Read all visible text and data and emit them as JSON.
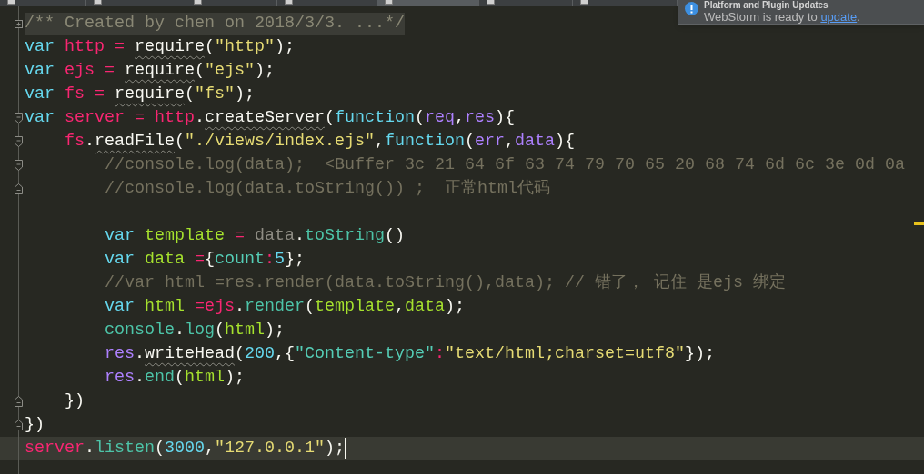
{
  "tabs": [
    {
      "selected": false
    },
    {
      "selected": false
    },
    {
      "selected": false
    },
    {
      "selected": false
    },
    {
      "selected": true
    },
    {
      "selected": false
    },
    {
      "selected": false
    }
  ],
  "notification": {
    "title": "Platform and Plugin Updates",
    "message": "WebStorm is ready to",
    "link": "update",
    "after_link": "."
  },
  "editor": {
    "lines": [
      {
        "kind": "folded",
        "current": false,
        "tokens": [
          {
            "text": "/** Created by chen on 2018/3/3. ...*/",
            "kind": "folded"
          }
        ]
      },
      {
        "kind": "plain",
        "current": false,
        "tokens": [
          {
            "text": "var ",
            "kind": "keyword"
          },
          {
            "text": "http ",
            "kind": "variable"
          },
          {
            "text": "= ",
            "kind": "operator"
          },
          {
            "text": "require",
            "kind": "unresolved"
          },
          {
            "text": "(",
            "kind": "plain"
          },
          {
            "text": "\"http\"",
            "kind": "string"
          },
          {
            "text": ");",
            "kind": "plain"
          }
        ]
      },
      {
        "kind": "plain",
        "current": false,
        "tokens": [
          {
            "text": "var ",
            "kind": "keyword"
          },
          {
            "text": "ejs ",
            "kind": "variable"
          },
          {
            "text": "= ",
            "kind": "operator"
          },
          {
            "text": "require",
            "kind": "unresolved"
          },
          {
            "text": "(",
            "kind": "plain"
          },
          {
            "text": "\"ejs\"",
            "kind": "string"
          },
          {
            "text": ");",
            "kind": "plain"
          }
        ]
      },
      {
        "kind": "plain",
        "current": false,
        "tokens": [
          {
            "text": "var ",
            "kind": "keyword"
          },
          {
            "text": "fs ",
            "kind": "variable"
          },
          {
            "text": "= ",
            "kind": "operator"
          },
          {
            "text": "require",
            "kind": "unresolved"
          },
          {
            "text": "(",
            "kind": "plain"
          },
          {
            "text": "\"fs\"",
            "kind": "string"
          },
          {
            "text": ");",
            "kind": "plain"
          }
        ]
      },
      {
        "kind": "fold_start",
        "current": false,
        "tokens": [
          {
            "text": "var ",
            "kind": "keyword"
          },
          {
            "text": "server ",
            "kind": "variable"
          },
          {
            "text": "= ",
            "kind": "operator"
          },
          {
            "text": "http",
            "kind": "variable"
          },
          {
            "text": ".",
            "kind": "plain"
          },
          {
            "text": "createServer",
            "kind": "unresolved"
          },
          {
            "text": "(",
            "kind": "plain"
          },
          {
            "text": "function",
            "kind": "keyword"
          },
          {
            "text": "(",
            "kind": "plain"
          },
          {
            "text": "req",
            "kind": "param"
          },
          {
            "text": ",",
            "kind": "plain"
          },
          {
            "text": "res",
            "kind": "param"
          },
          {
            "text": "){",
            "kind": "plain"
          }
        ],
        "children": [
          {
            "kind": "fold_start",
            "current": false,
            "tokens": [
              {
                "text": "fs",
                "kind": "variable"
              },
              {
                "text": ".",
                "kind": "plain"
              },
              {
                "text": "readFile",
                "kind": "unresolved"
              },
              {
                "text": "(",
                "kind": "plain"
              },
              {
                "text": "\"./views/index.ejs\"",
                "kind": "string"
              },
              {
                "text": ",",
                "kind": "plain"
              },
              {
                "text": "function",
                "kind": "keyword"
              },
              {
                "text": "(",
                "kind": "plain"
              },
              {
                "text": "err",
                "kind": "param"
              },
              {
                "text": ",",
                "kind": "plain"
              },
              {
                "text": "data",
                "kind": "param"
              },
              {
                "text": "){",
                "kind": "plain"
              }
            ],
            "children": [
              {
                "kind": "fold_start",
                "current": false,
                "tokens": [
                  {
                    "text": "//console.log(data);  <Buffer 3c 21 64 6f 63 74 79 70 65 20 68 74 6d 6c 3e 0d 0a",
                    "kind": "comment"
                  }
                ]
              },
              {
                "kind": "fold_end",
                "current": false,
                "tokens": [
                  {
                    "text": "//console.log(data.toString()) ;  正常html代码",
                    "kind": "comment"
                  }
                ]
              },
              {
                "kind": "plain",
                "current": false
              },
              {
                "kind": "plain",
                "current": false,
                "tokens": [
                  {
                    "text": "var ",
                    "kind": "keyword"
                  },
                  {
                    "text": "template ",
                    "kind": "local"
                  },
                  {
                    "text": "= ",
                    "kind": "operator"
                  },
                  {
                    "text": "data",
                    "kind": "dim"
                  },
                  {
                    "text": ".",
                    "kind": "plain"
                  },
                  {
                    "text": "toString",
                    "kind": "method"
                  },
                  {
                    "text": "()",
                    "kind": "plain"
                  }
                ]
              },
              {
                "kind": "plain",
                "current": false,
                "tokens": [
                  {
                    "text": "var ",
                    "kind": "keyword"
                  },
                  {
                    "text": "data ",
                    "kind": "local"
                  },
                  {
                    "text": "=",
                    "kind": "operator"
                  },
                  {
                    "text": "{",
                    "kind": "plain"
                  },
                  {
                    "text": "count",
                    "kind": "property"
                  },
                  {
                    "text": ":",
                    "kind": "operator"
                  },
                  {
                    "text": "5",
                    "kind": "number"
                  },
                  {
                    "text": "};",
                    "kind": "plain"
                  }
                ]
              },
              {
                "kind": "plain",
                "current": false,
                "tokens": [
                  {
                    "text": "//var html =res.render(data.toString(),data); // 错了， 记住 是ejs 绑定",
                    "kind": "comment"
                  }
                ]
              },
              {
                "kind": "plain",
                "current": false,
                "tokens": [
                  {
                    "text": "var ",
                    "kind": "keyword"
                  },
                  {
                    "text": "html ",
                    "kind": "local"
                  },
                  {
                    "text": "=",
                    "kind": "operator"
                  },
                  {
                    "text": "ejs",
                    "kind": "variable"
                  },
                  {
                    "text": ".",
                    "kind": "plain"
                  },
                  {
                    "text": "render",
                    "kind": "method"
                  },
                  {
                    "text": "(",
                    "kind": "plain"
                  },
                  {
                    "text": "template",
                    "kind": "local"
                  },
                  {
                    "text": ",",
                    "kind": "plain"
                  },
                  {
                    "text": "data",
                    "kind": "local"
                  },
                  {
                    "text": ");",
                    "kind": "plain"
                  }
                ]
              },
              {
                "kind": "plain",
                "current": false,
                "tokens": [
                  {
                    "text": "console",
                    "kind": "method"
                  },
                  {
                    "text": ".",
                    "kind": "plain"
                  },
                  {
                    "text": "log",
                    "kind": "method"
                  },
                  {
                    "text": "(",
                    "kind": "plain"
                  },
                  {
                    "text": "html",
                    "kind": "local"
                  },
                  {
                    "text": ");",
                    "kind": "plain"
                  }
                ]
              },
              {
                "kind": "plain",
                "current": false,
                "tokens": [
                  {
                    "text": "res",
                    "kind": "param"
                  },
                  {
                    "text": ".",
                    "kind": "plain"
                  },
                  {
                    "text": "writeHead",
                    "kind": "unresolved"
                  },
                  {
                    "text": "(",
                    "kind": "plain"
                  },
                  {
                    "text": "200",
                    "kind": "number"
                  },
                  {
                    "text": ",{",
                    "kind": "plain"
                  },
                  {
                    "text": "\"Content-type\"",
                    "kind": "property"
                  },
                  {
                    "text": ":",
                    "kind": "operator"
                  },
                  {
                    "text": "\"text/html;charset=utf8\"",
                    "kind": "string"
                  },
                  {
                    "text": "});",
                    "kind": "plain"
                  }
                ]
              },
              {
                "kind": "plain",
                "current": false,
                "tokens": [
                  {
                    "text": "res",
                    "kind": "param"
                  },
                  {
                    "text": ".",
                    "kind": "plain"
                  },
                  {
                    "text": "end",
                    "kind": "method"
                  },
                  {
                    "text": "(",
                    "kind": "plain"
                  },
                  {
                    "text": "html",
                    "kind": "local"
                  },
                  {
                    "text": ");",
                    "kind": "plain"
                  }
                ]
              }
            ]
          },
          {
            "kind": "fold_end",
            "current": false,
            "tokens": [
              {
                "text": "})",
                "kind": "plain"
              }
            ]
          }
        ]
      },
      {
        "kind": "fold_end",
        "current": false,
        "tokens": [
          {
            "text": "})",
            "kind": "plain"
          }
        ]
      },
      {
        "kind": "plain",
        "current": true,
        "tokens": [
          {
            "text": "server",
            "kind": "variable"
          },
          {
            "text": ".",
            "kind": "plain"
          },
          {
            "text": "listen",
            "kind": "method"
          },
          {
            "text": "(",
            "kind": "plain"
          },
          {
            "text": "3000",
            "kind": "number"
          },
          {
            "text": ",",
            "kind": "plain"
          },
          {
            "text": "\"127.0.0.1\"",
            "kind": "string"
          },
          {
            "text": ");",
            "kind": "plain"
          }
        ]
      }
    ]
  }
}
